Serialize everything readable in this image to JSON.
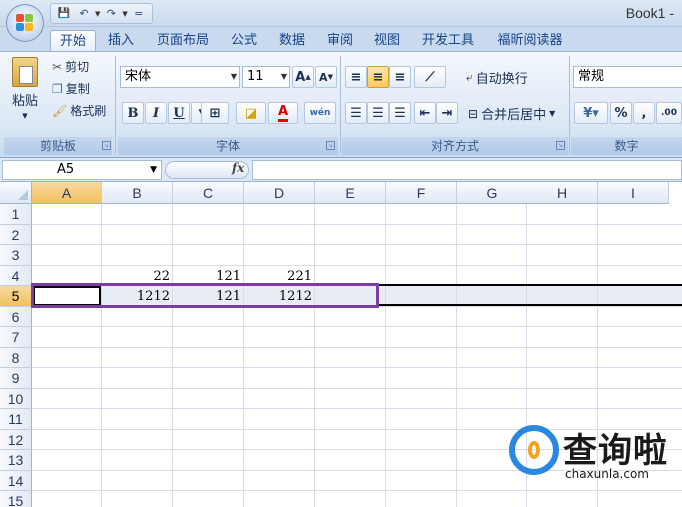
{
  "window": {
    "title": "Book1 -"
  },
  "quick_access": {
    "save": "💾",
    "undo": "↶",
    "redo": "↷",
    "customize": "="
  },
  "tabs": [
    "开始",
    "插入",
    "页面布局",
    "公式",
    "数据",
    "审阅",
    "视图",
    "开发工具",
    "福昕阅读器"
  ],
  "clipboard": {
    "paste": "粘贴",
    "cut": "剪切",
    "copy": "复制",
    "format_painter": "格式刷",
    "group_label": "剪贴板"
  },
  "font": {
    "name": "宋体",
    "size": "11",
    "grow": "A",
    "shrink": "A",
    "bold": "B",
    "italic": "I",
    "underline": "U",
    "group_label": "字体",
    "phonetic": "wén"
  },
  "alignment": {
    "wrap_text": "自动换行",
    "merge_center": "合并后居中",
    "group_label": "对齐方式"
  },
  "number": {
    "format": "常规",
    "percent": "%",
    "comma": ",",
    "decimal": ".00",
    "group_label": "数字"
  },
  "formula_bar": {
    "name_box": "A5",
    "fx": "fx",
    "value": ""
  },
  "columns": [
    "A",
    "B",
    "C",
    "D",
    "E",
    "F",
    "G",
    "H",
    "I"
  ],
  "rows": [
    "1",
    "2",
    "3",
    "4",
    "5",
    "6",
    "7",
    "8",
    "9",
    "10",
    "11",
    "12",
    "13",
    "14",
    "15"
  ],
  "cells": {
    "B4": "22",
    "C4": "121",
    "D4": "221",
    "B5": "1212",
    "C5": "121",
    "D5": "1212"
  },
  "watermark": {
    "brand": "查询啦",
    "domain": "chaxunla.com"
  },
  "colors": {
    "accent": "#7d3ba6",
    "selection": "#f1c15f",
    "ribbon": "#dbe7f5"
  }
}
